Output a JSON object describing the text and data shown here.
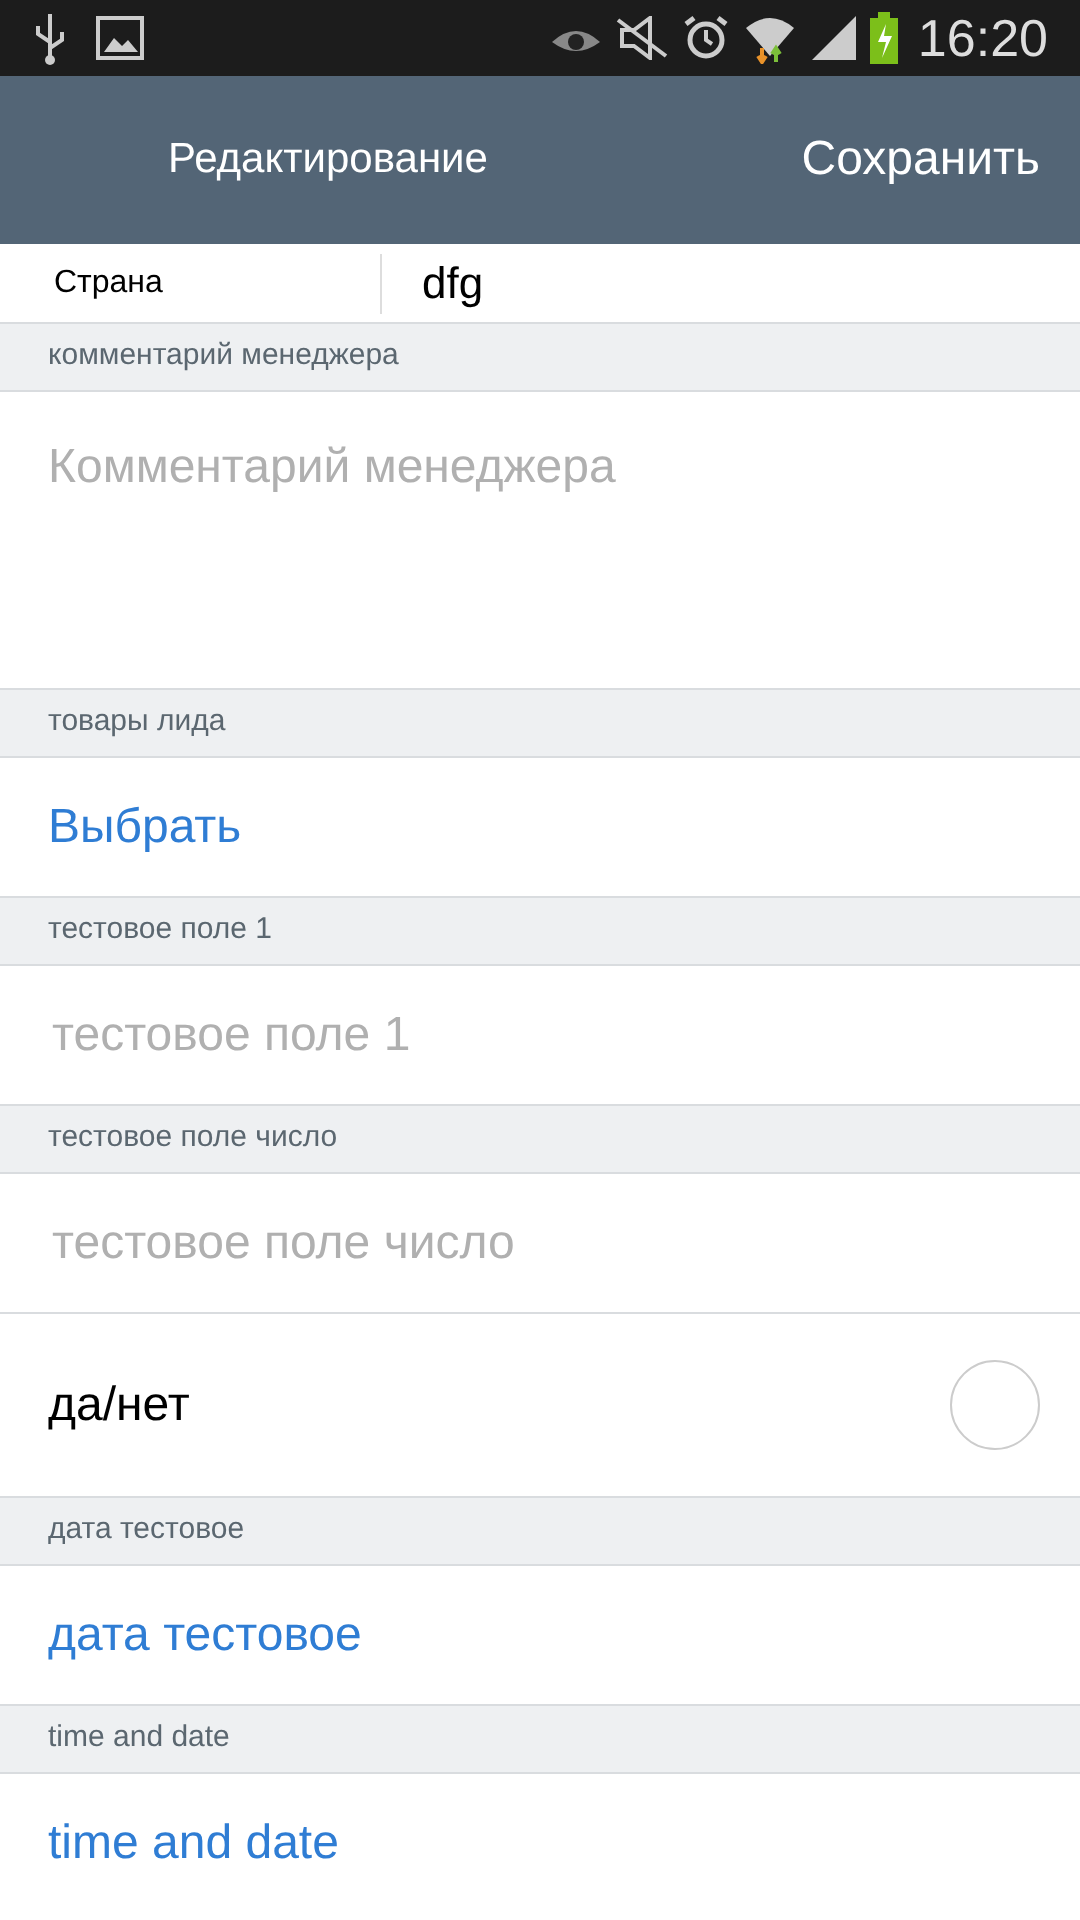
{
  "status_bar": {
    "time": "16:20"
  },
  "header": {
    "title": "Редактирование",
    "action": "Сохранить"
  },
  "country_row": {
    "label": "Страна",
    "value": "dfg"
  },
  "items": [
    {
      "kind": "section",
      "text": "комментарий менеджера"
    },
    {
      "kind": "textarea",
      "placeholder": "Комментарий менеджера"
    },
    {
      "kind": "section",
      "text": "товары лида"
    },
    {
      "kind": "link",
      "text": "Выбрать"
    },
    {
      "kind": "section",
      "text": "тестовое поле 1"
    },
    {
      "kind": "input",
      "placeholder": "тестовое поле 1"
    },
    {
      "kind": "section",
      "text": "тестовое поле число"
    },
    {
      "kind": "input",
      "placeholder": "тестовое поле число"
    },
    {
      "kind": "toggle",
      "text": "да/нет",
      "checked": false
    },
    {
      "kind": "section",
      "text": "дата тестовое"
    },
    {
      "kind": "link",
      "text": "дата тестовое"
    },
    {
      "kind": "section",
      "text": "time and date"
    },
    {
      "kind": "link",
      "text": "time and date"
    }
  ]
}
